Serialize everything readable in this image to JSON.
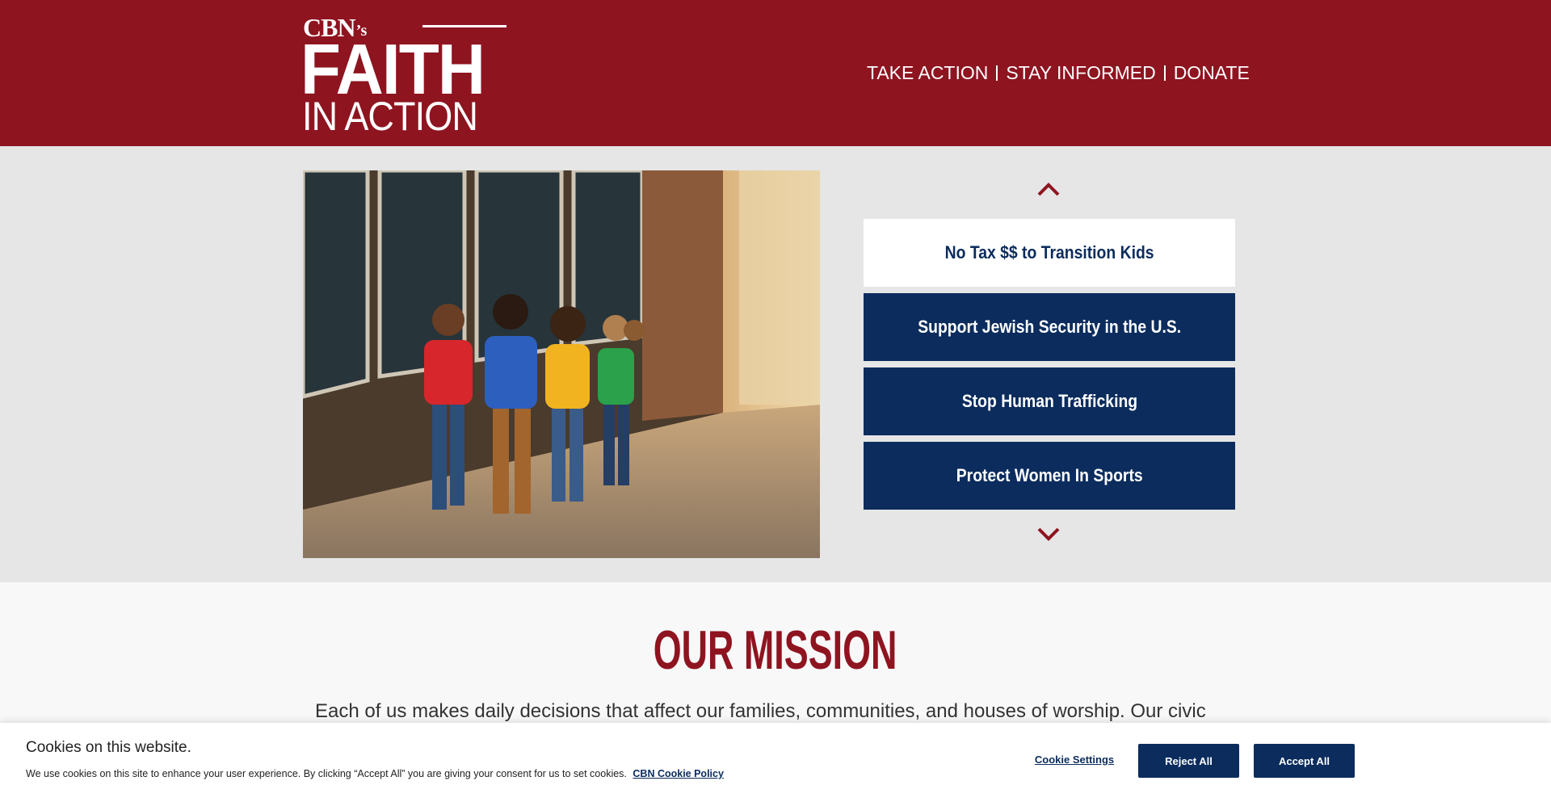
{
  "brand": {
    "cbn": "CBN",
    "possessive": "’s",
    "faith": "FAITH",
    "in_action": "IN ACTION",
    "color": "#8e1420"
  },
  "nav": {
    "items": [
      {
        "label": "TAKE ACTION"
      },
      {
        "label": "STAY INFORMED"
      },
      {
        "label": "DONATE"
      }
    ]
  },
  "hero": {
    "image_icon": "children-with-backpacks-photo",
    "up_icon": "chevron-up-icon",
    "down_icon": "chevron-down-icon",
    "menu": [
      {
        "label": "No Tax $$ to Transition Kids",
        "active": true
      },
      {
        "label": "Support Jewish Security in the U.S.",
        "active": false
      },
      {
        "label": "Stop Human Trafficking",
        "active": false
      },
      {
        "label": "Protect Women In Sports",
        "active": false
      }
    ],
    "colors": {
      "navy": "#0b2c5d",
      "arrow": "#8e1420"
    }
  },
  "mission": {
    "title": "OUR MISSION",
    "text": "Each of us makes daily decisions that affect our families, communities, and houses of worship. Our civic"
  },
  "cookie": {
    "title": "Cookies on this website.",
    "text": "We use cookies on this site to enhance your user experience. By clicking “Accept All” you are giving your consent for us to set cookies.",
    "policy_link": "CBN Cookie Policy",
    "settings": "Cookie Settings",
    "reject": "Reject All",
    "accept": "Accept All"
  }
}
